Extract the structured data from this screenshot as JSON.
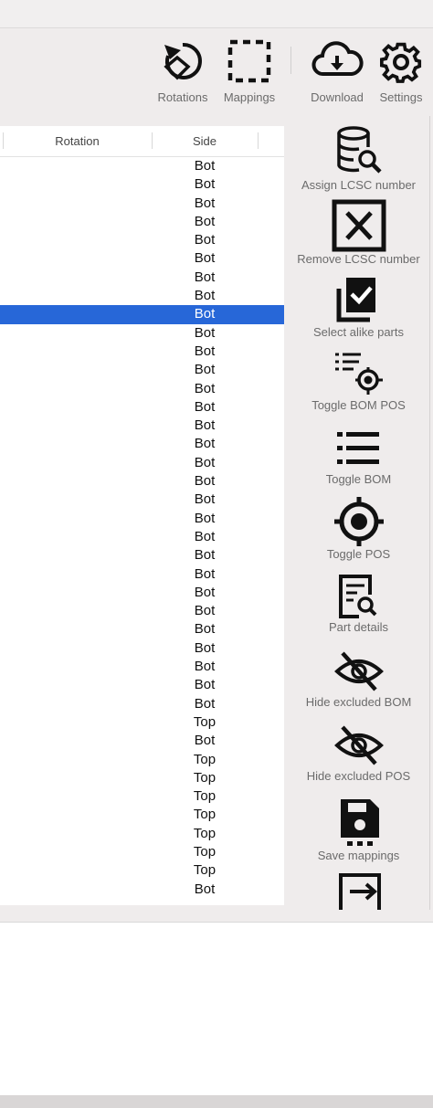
{
  "toolbar": {
    "rotations_label": "Rotations",
    "mappings_label": "Mappings",
    "download_label": "Download",
    "settings_label": "Settings"
  },
  "table": {
    "headers": {
      "rotation": "Rotation",
      "side": "Side"
    },
    "rows": [
      "Bot",
      "Bot",
      "Bot",
      "Bot",
      "Bot",
      "Bot",
      "Bot",
      "Bot",
      "Bot",
      "Bot",
      "Bot",
      "Bot",
      "Bot",
      "Bot",
      "Bot",
      "Bot",
      "Bot",
      "Bot",
      "Bot",
      "Bot",
      "Bot",
      "Bot",
      "Bot",
      "Bot",
      "Bot",
      "Bot",
      "Bot",
      "Bot",
      "Bot",
      "Bot",
      "Top",
      "Bot",
      "Top",
      "Top",
      "Top",
      "Top",
      "Top",
      "Top",
      "Top",
      "Bot"
    ],
    "selected_row_index": 8
  },
  "sidepanel": {
    "assign_lcsc": "Assign LCSC number",
    "remove_lcsc": "Remove LCSC number",
    "select_alike": "Select alike parts",
    "toggle_bom_pos": "Toggle BOM  POS",
    "toggle_bom": "Toggle BOM",
    "toggle_pos": "Toggle POS",
    "part_details": "Part details",
    "hide_excluded_bom": "Hide excluded BOM",
    "hide_excluded_pos": "Hide excluded POS",
    "save_mappings": "Save mappings"
  },
  "colors": {
    "selection": "#2767d8",
    "icon": "#111111",
    "label": "#6b6b6b"
  }
}
